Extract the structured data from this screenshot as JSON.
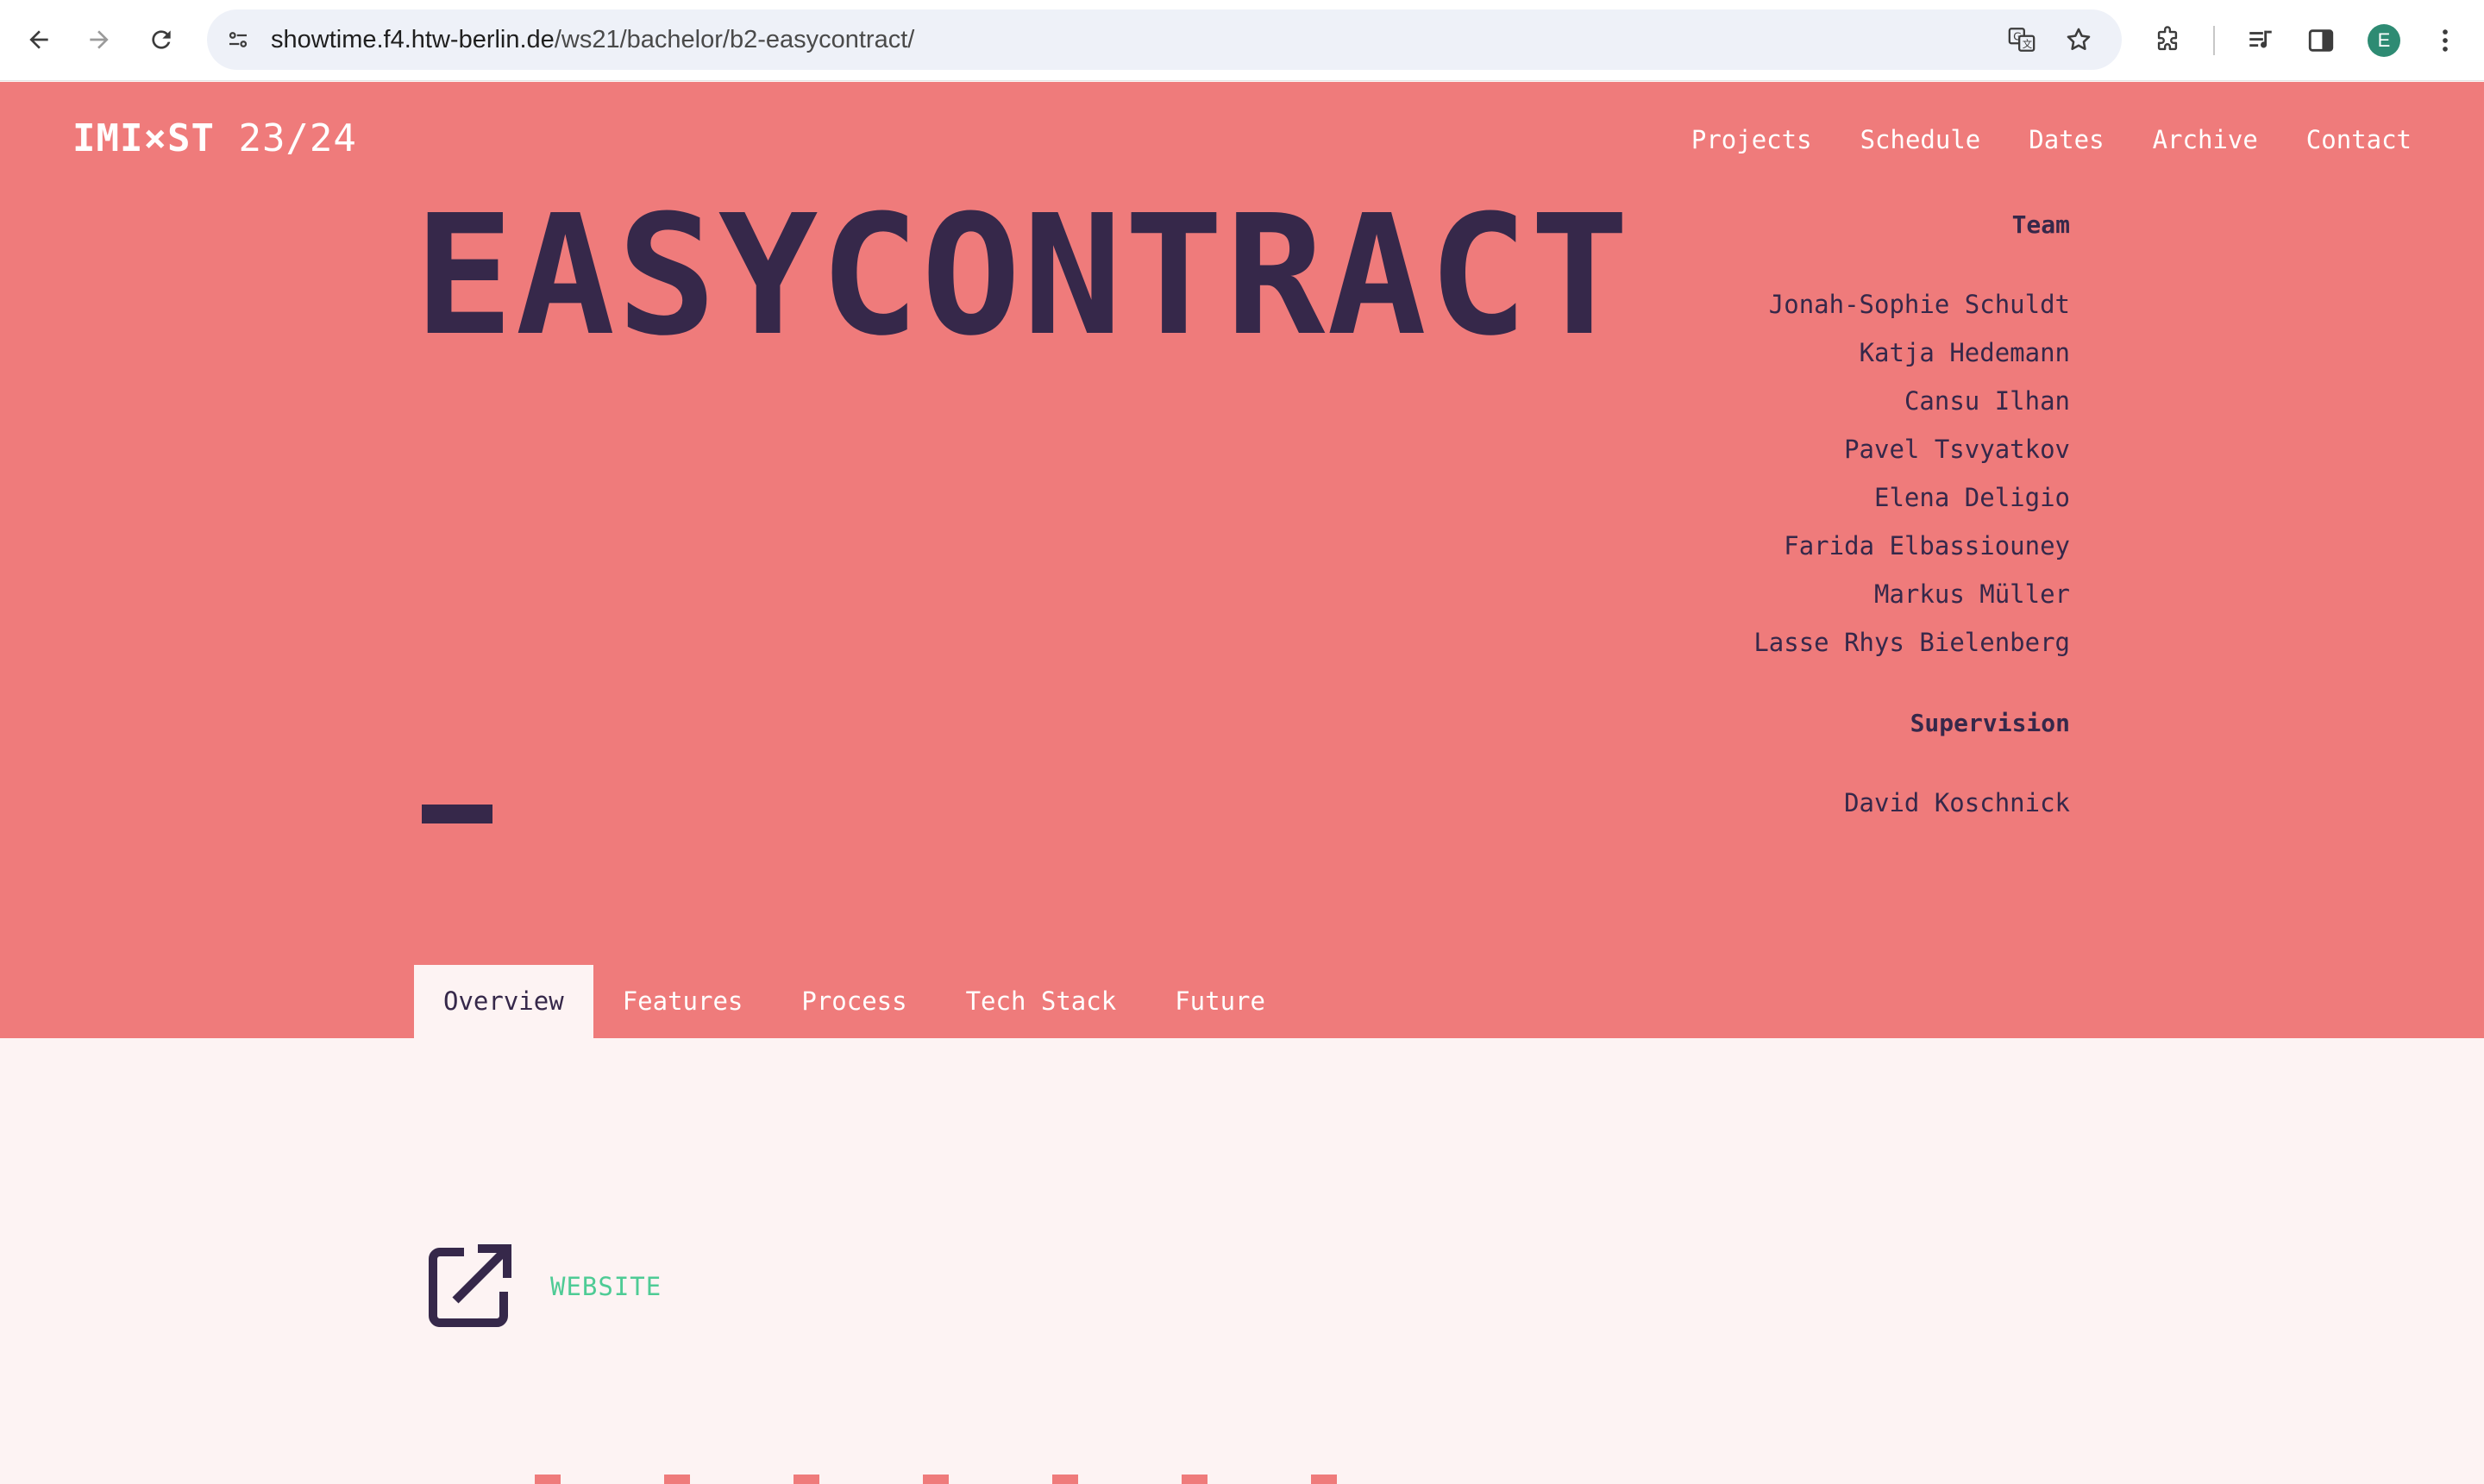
{
  "browser": {
    "url_host": "showtime.f4.htw-berlin.de",
    "url_path": "/ws21/bachelor/b2-easycontract/",
    "avatar_letter": "E",
    "icons": [
      "back-arrow-icon",
      "forward-arrow-icon",
      "reload-icon",
      "site-settings-icon",
      "translate-icon",
      "bookmark-star-icon",
      "extensions-icon",
      "media-controls-icon",
      "side-panel-icon",
      "more-menu-icon"
    ]
  },
  "site": {
    "logo_strong": "IMI×ST",
    "logo_year": "23/24",
    "nav": [
      "Projects",
      "Schedule",
      "Dates",
      "Archive",
      "Contact"
    ]
  },
  "project": {
    "title": "EASYCONTRACT",
    "team_heading": "Team",
    "team": [
      "Jonah-Sophie Schuldt",
      "Katja Hedemann",
      "Cansu Ilhan",
      "Pavel Tsvyatkov",
      "Elena Deligio",
      "Farida Elbassiouney",
      "Markus Müller",
      "Lasse Rhys Bielenberg"
    ],
    "supervision_heading": "Supervision",
    "supervisors": [
      "David Koschnick"
    ]
  },
  "tabs": [
    {
      "label": "Overview",
      "active": true
    },
    {
      "label": "Features",
      "active": false
    },
    {
      "label": "Process",
      "active": false
    },
    {
      "label": "Tech Stack",
      "active": false
    },
    {
      "label": "Future",
      "active": false
    }
  ],
  "content": {
    "website_label": "WEBSITE",
    "website_icon": "external-link-icon"
  },
  "colors": {
    "hero_bg": "#ef7b7b",
    "page_bg": "#fdf3f3",
    "ink": "#36284a",
    "accent_green": "#4ecb95"
  }
}
